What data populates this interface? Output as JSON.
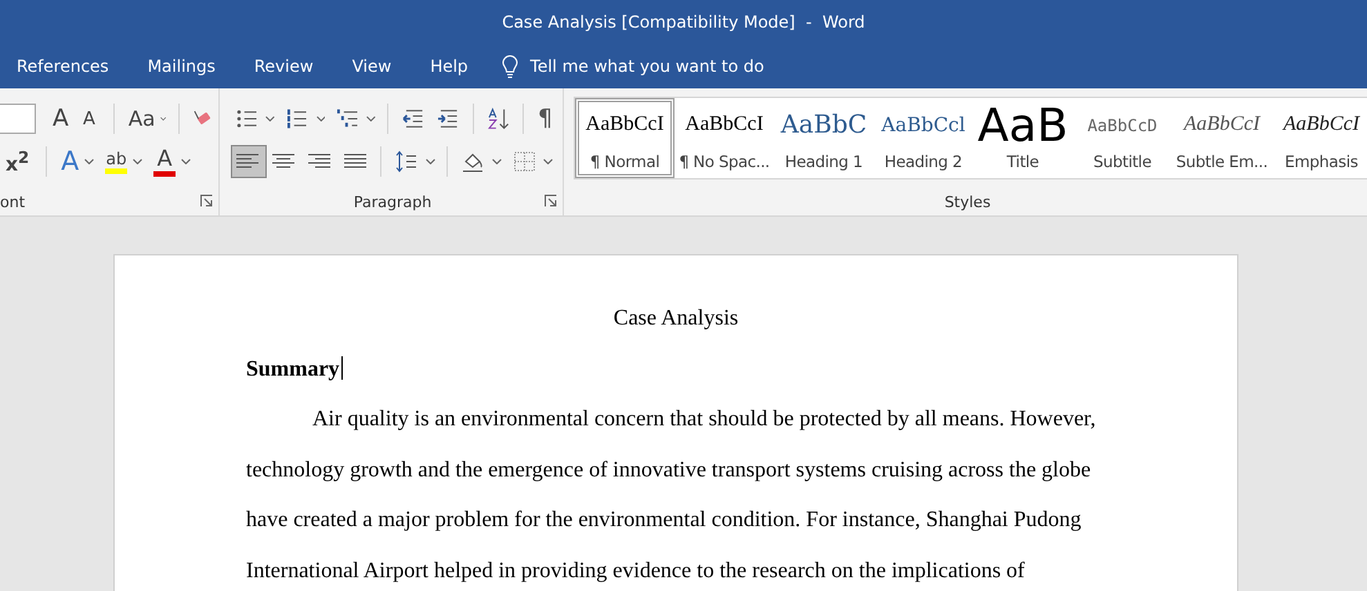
{
  "window": {
    "title": "Case Analysis [Compatibility Mode]  -  Word"
  },
  "tabs": [
    {
      "label": "References",
      "selected": false
    },
    {
      "label": "Mailings",
      "selected": false
    },
    {
      "label": "Review",
      "selected": false
    },
    {
      "label": "View",
      "selected": false
    },
    {
      "label": "Help",
      "selected": false
    }
  ],
  "tell_me": {
    "placeholder": "Tell me what you want to do"
  },
  "font_group": {
    "label": "ont",
    "rows": [
      [
        {
          "kind": "size"
        },
        {
          "kind": "grow",
          "label": "A"
        },
        {
          "kind": "shrink",
          "label": "A"
        },
        {
          "kind": "case",
          "label": "Aa",
          "dropdown": true
        },
        {
          "kind": "clear"
        }
      ],
      [
        {
          "kind": "superscript",
          "label": "x$^{2}$"
        },
        {
          "kind": "effects",
          "label": "A",
          "dropdown": true
        },
        {
          "kind": "highlight",
          "label": "ab",
          "color": "#ffff00",
          "dropdown": true
        },
        {
          "kind": "fontcolor",
          "label": "A",
          "color": "#e00000",
          "dropdown": true
        }
      ]
    ]
  },
  "paragraph_group": {
    "label": "Paragraph",
    "rows": [
      [
        {
          "kind": "bullets",
          "dropdown": true
        },
        {
          "kind": "numbering",
          "dropdown": true
        },
        {
          "kind": "multilevel",
          "dropdown": true
        },
        {
          "kind": "outdent"
        },
        {
          "kind": "indent"
        },
        {
          "kind": "sort"
        },
        {
          "kind": "marks",
          "label": "¶"
        }
      ],
      [
        {
          "kind": "left",
          "selected": true
        },
        {
          "kind": "center",
          "selected": false
        },
        {
          "kind": "right",
          "selected": false
        },
        {
          "kind": "justify",
          "selected": false
        },
        {
          "kind": "spacing",
          "dropdown": true
        },
        {
          "kind": "shading",
          "dropdown": true
        },
        {
          "kind": "borders",
          "dropdown": true
        }
      ]
    ]
  },
  "styles_group": {
    "label": "Styles",
    "items": [
      {
        "kind": "normal",
        "preview": "AaBbCcI",
        "name": "¶ Normal",
        "selected": true
      },
      {
        "kind": "plain",
        "preview": "AaBbCcI",
        "name": "¶ No Spac...",
        "selected": false
      },
      {
        "kind": "heading",
        "preview": "AaBbC",
        "name": "Heading 1",
        "selected": false
      },
      {
        "kind": "subheading",
        "preview": "AaBbCcl",
        "name": "Heading 2",
        "selected": false
      },
      {
        "kind": "title",
        "preview": "AaB",
        "name": "Title",
        "selected": false
      },
      {
        "kind": "subtitle",
        "preview": "AaBbCcD",
        "name": "Subtitle",
        "selected": false
      },
      {
        "kind": "subtle",
        "preview": "AaBbCcI",
        "name": "Subtle Em...",
        "selected": false
      },
      {
        "kind": "emphasis",
        "preview": "AaBbCcI",
        "name": "Emphasis",
        "selected": false
      }
    ]
  },
  "document": {
    "title": "Case Analysis",
    "heading": "Summary",
    "paragraph": "Air quality is an environmental concern that should be protected by all means. However, technology growth and the emergence of innovative transport systems cruising across the globe have created a major problem for the environmental condition. For instance, Shanghai Pudong International Airport helped in providing evidence to the research on the implications of"
  }
}
